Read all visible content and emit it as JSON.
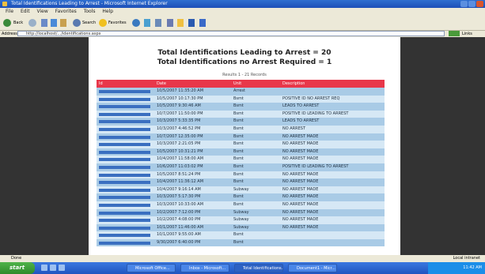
{
  "window": {
    "title": "Total Identifications Leading to Arrest - Microsoft Internet Explorer"
  },
  "menu": [
    "File",
    "Edit",
    "View",
    "Favorites",
    "Tools",
    "Help"
  ],
  "toolbar": {
    "back_label": "Back",
    "search_label": "Search",
    "favorites_label": "Favorites"
  },
  "address": {
    "label": "Address",
    "value": "http://localhost/.../identifications.aspx",
    "links_label": "Links"
  },
  "report": {
    "line1": "Total Identifications Leading to Arrest = 20",
    "line2": "Total Identifications no Arrest Required = 1",
    "caption": "Results 1 - 21 Records",
    "columns": [
      "Id",
      "Date",
      "Unit",
      "Description"
    ],
    "rows": [
      {
        "date": "10/5/2007 11:35:20 AM",
        "unit": "Arrest",
        "desc": ""
      },
      {
        "date": "10/5/2007 10:17:30 PM",
        "unit": "Bsmt",
        "desc": "POSITIVE ID NO ARREST REQ"
      },
      {
        "date": "10/5/2007 9:30:46 AM",
        "unit": "Bsmt",
        "desc": "LEADS TO ARREST"
      },
      {
        "date": "10/7/2007 11:50:00 PM",
        "unit": "Bsmt",
        "desc": "POSITIVE ID LEADING TO ARREST"
      },
      {
        "date": "10/3/2007 5:33:35 PM",
        "unit": "Bsmt",
        "desc": "LEADS TO ARREST"
      },
      {
        "date": "10/3/2007 4:46:52 PM",
        "unit": "Bsmt",
        "desc": "NO ARREST"
      },
      {
        "date": "10/7/2007 12:35:00 PM",
        "unit": "Bsmt",
        "desc": "NO ARREST MADE"
      },
      {
        "date": "10/3/2007 2:21:05 PM",
        "unit": "Bsmt",
        "desc": "NO ARREST MADE"
      },
      {
        "date": "10/5/2007 10:31:21 PM",
        "unit": "Bsmt",
        "desc": "NO ARREST MADE"
      },
      {
        "date": "10/4/2007 11:58:00 AM",
        "unit": "Bsmt",
        "desc": "NO ARREST MADE"
      },
      {
        "date": "10/6/2007 11:03:02 PM",
        "unit": "Bsmt",
        "desc": "POSITIVE ID LEADING TO ARREST"
      },
      {
        "date": "10/5/2007 8:51:24 PM",
        "unit": "Bsmt",
        "desc": "NO ARREST MADE"
      },
      {
        "date": "10/4/2007 11:36:12 AM",
        "unit": "Bsmt",
        "desc": "NO ARREST MADE"
      },
      {
        "date": "10/4/2007 9:16:14 AM",
        "unit": "Subway",
        "desc": "NO ARREST MADE"
      },
      {
        "date": "10/3/2007 5:17:30 PM",
        "unit": "Bsmt",
        "desc": "NO ARREST MADE"
      },
      {
        "date": "10/3/2007 10:33:00 AM",
        "unit": "Bsmt",
        "desc": "NO ARREST MADE"
      },
      {
        "date": "10/2/2007 7:12:00 PM",
        "unit": "Subway",
        "desc": "NO ARREST MADE"
      },
      {
        "date": "10/2/2007 4:08:00 PM",
        "unit": "Subway",
        "desc": "NO ARREST MADE"
      },
      {
        "date": "10/1/2007 11:46:00 AM",
        "unit": "Subway",
        "desc": "NO ARREST MADE"
      },
      {
        "date": "10/1/2007 9:55:00 AM",
        "unit": "Bsmt",
        "desc": ""
      },
      {
        "date": "9/30/2007 6:40:00 PM",
        "unit": "Bsmt",
        "desc": ""
      }
    ]
  },
  "status": {
    "left": "Done",
    "right": "Local intranet"
  },
  "taskbar": {
    "start_label": "start",
    "tasks": [
      "Microsoft Office...",
      "Inbox - Microsoft...",
      "Total Identifications...",
      "Document1 - Micr..."
    ],
    "clock": "11:42 AM"
  },
  "colors": {
    "header_red": "#e8374a",
    "row_blue": "#a9cbe6",
    "row_light": "#d6e8f5",
    "xp_blue": "#1f55c0"
  }
}
